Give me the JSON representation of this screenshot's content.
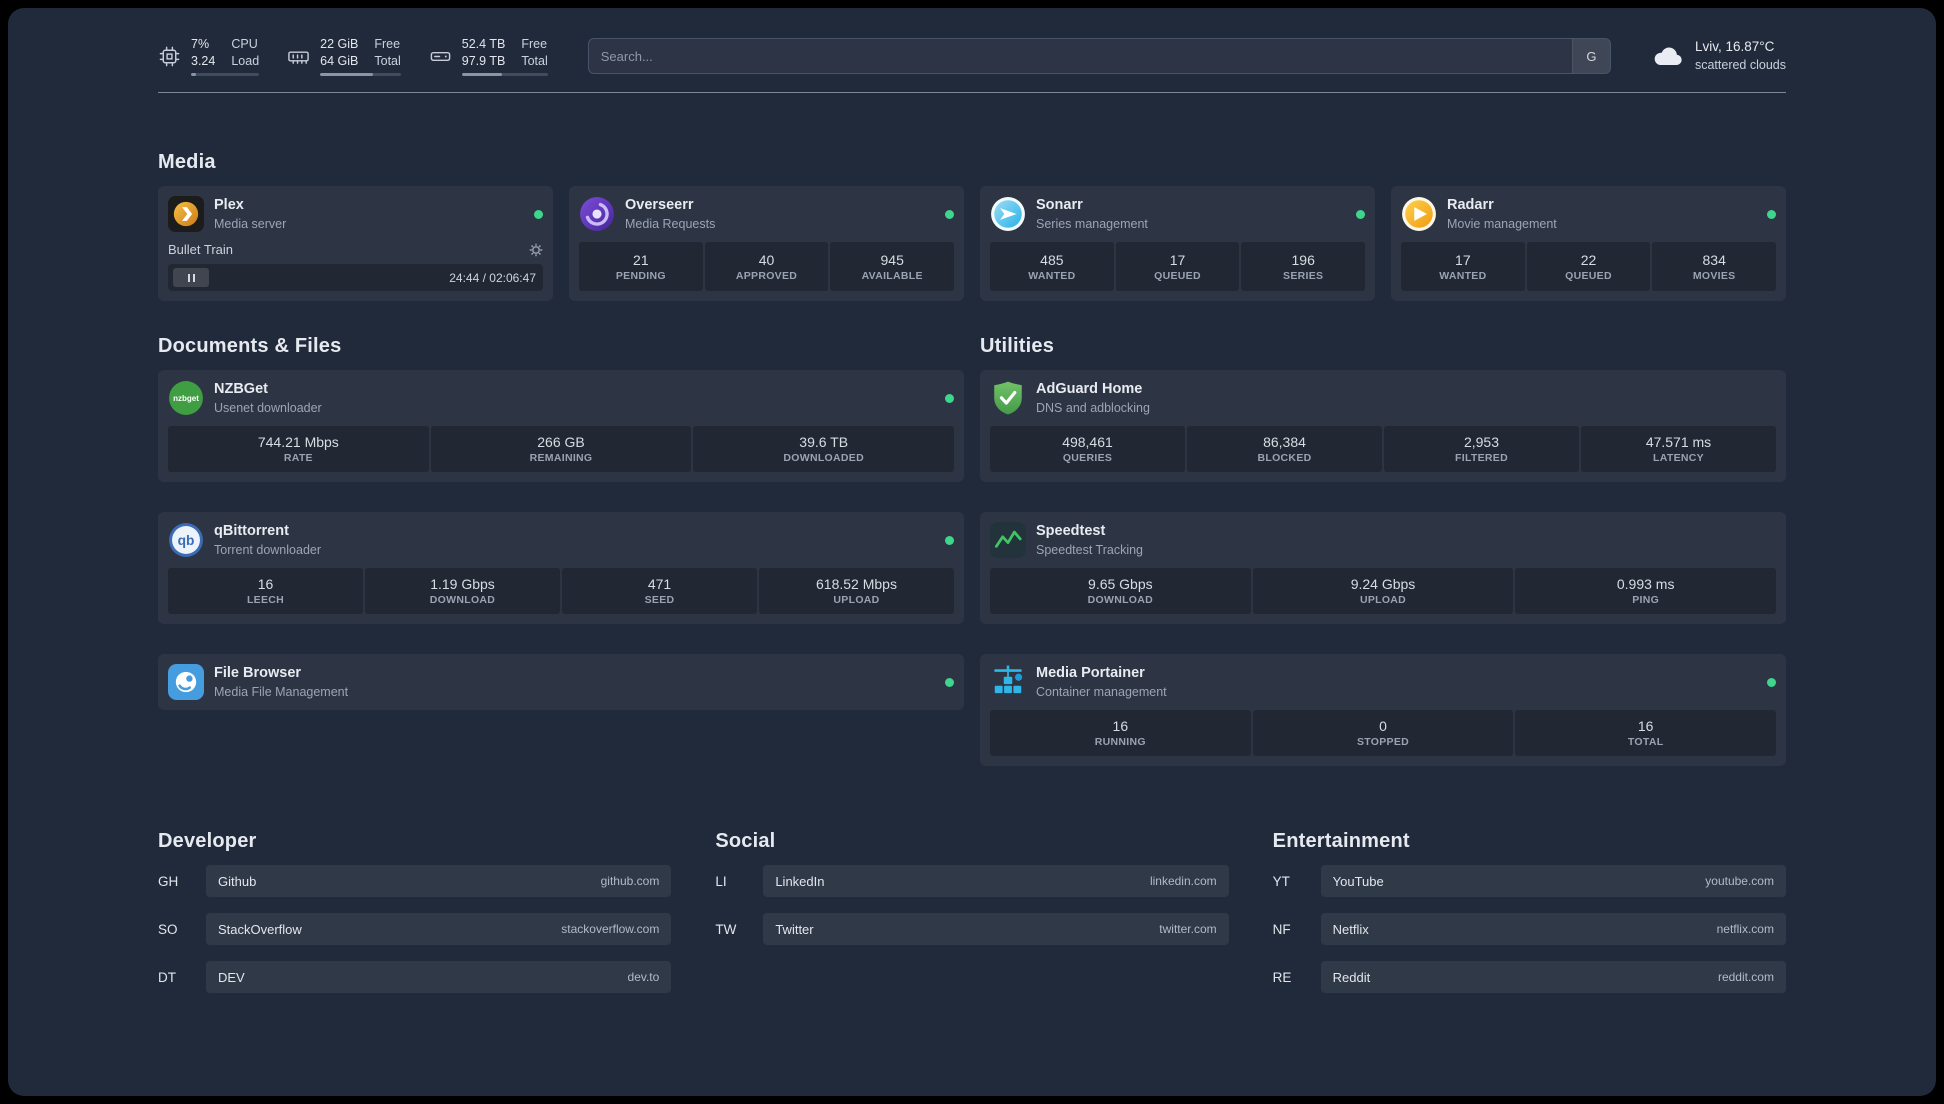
{
  "colors": {
    "status_online": "#3dd68c",
    "background": "#212a3b",
    "accent_green": "#40c463"
  },
  "topbar": {
    "resources": [
      {
        "icon": "cpu-icon",
        "values": [
          "7%",
          "3.24"
        ],
        "labels": [
          "CPU",
          "Load"
        ],
        "progress": 7
      },
      {
        "icon": "memory-icon",
        "values": [
          "22 GiB",
          "64 GiB"
        ],
        "labels": [
          "Free",
          "Total"
        ],
        "progress": 66
      },
      {
        "icon": "disk-icon",
        "values": [
          "52.4 TB",
          "97.9 TB"
        ],
        "labels": [
          "Free",
          "Total"
        ],
        "progress": 47
      }
    ],
    "search": {
      "placeholder": "Search...",
      "provider": "G"
    },
    "weather": {
      "location": "Lviv, 16.87°C",
      "condition": "scattered clouds"
    }
  },
  "media": {
    "title": "Media",
    "plex": {
      "name": "Plex",
      "subtitle": "Media server",
      "status": "online",
      "player": {
        "track": "Bullet Train",
        "time": "24:44 / 02:06:47"
      }
    },
    "overseerr": {
      "name": "Overseerr",
      "subtitle": "Media Requests",
      "status": "online",
      "stats": [
        {
          "value": "21",
          "label": "PENDING"
        },
        {
          "value": "40",
          "label": "APPROVED"
        },
        {
          "value": "945",
          "label": "AVAILABLE"
        }
      ]
    },
    "sonarr": {
      "name": "Sonarr",
      "subtitle": "Series management",
      "status": "online",
      "stats": [
        {
          "value": "485",
          "label": "WANTED"
        },
        {
          "value": "17",
          "label": "QUEUED"
        },
        {
          "value": "196",
          "label": "SERIES"
        }
      ]
    },
    "radarr": {
      "name": "Radarr",
      "subtitle": "Movie management",
      "status": "online",
      "stats": [
        {
          "value": "17",
          "label": "WANTED"
        },
        {
          "value": "22",
          "label": "QUEUED"
        },
        {
          "value": "834",
          "label": "MOVIES"
        }
      ]
    }
  },
  "documents": {
    "title": "Documents & Files",
    "nzbget": {
      "name": "NZBGet",
      "subtitle": "Usenet downloader",
      "status": "online",
      "stats": [
        {
          "value": "744.21 Mbps",
          "label": "RATE"
        },
        {
          "value": "266 GB",
          "label": "REMAINING"
        },
        {
          "value": "39.6 TB",
          "label": "DOWNLOADED"
        }
      ]
    },
    "qbittorrent": {
      "name": "qBittorrent",
      "subtitle": "Torrent downloader",
      "status": "online",
      "stats": [
        {
          "value": "16",
          "label": "LEECH"
        },
        {
          "value": "1.19 Gbps",
          "label": "DOWNLOAD"
        },
        {
          "value": "471",
          "label": "SEED"
        },
        {
          "value": "618.52 Mbps",
          "label": "UPLOAD"
        }
      ]
    },
    "filebrowser": {
      "name": "File Browser",
      "subtitle": "Media File Management",
      "status": "online"
    }
  },
  "utilities": {
    "title": "Utilities",
    "adguard": {
      "name": "AdGuard Home",
      "subtitle": "DNS and adblocking",
      "stats": [
        {
          "value": "498,461",
          "label": "QUERIES"
        },
        {
          "value": "86,384",
          "label": "BLOCKED"
        },
        {
          "value": "2,953",
          "label": "FILTERED"
        },
        {
          "value": "47.571 ms",
          "label": "LATENCY"
        }
      ]
    },
    "speedtest": {
      "name": "Speedtest",
      "subtitle": "Speedtest Tracking",
      "stats": [
        {
          "value": "9.65 Gbps",
          "label": "DOWNLOAD"
        },
        {
          "value": "9.24 Gbps",
          "label": "UPLOAD"
        },
        {
          "value": "0.993 ms",
          "label": "PING"
        }
      ]
    },
    "portainer": {
      "name": "Media Portainer",
      "subtitle": "Container management",
      "status": "online",
      "stats": [
        {
          "value": "16",
          "label": "RUNNING"
        },
        {
          "value": "0",
          "label": "STOPPED"
        },
        {
          "value": "16",
          "label": "TOTAL"
        }
      ]
    }
  },
  "bookmarks": {
    "developer": {
      "title": "Developer",
      "items": [
        {
          "abbr": "GH",
          "name": "Github",
          "url": "github.com"
        },
        {
          "abbr": "SO",
          "name": "StackOverflow",
          "url": "stackoverflow.com"
        },
        {
          "abbr": "DT",
          "name": "DEV",
          "url": "dev.to"
        }
      ]
    },
    "social": {
      "title": "Social",
      "items": [
        {
          "abbr": "LI",
          "name": "LinkedIn",
          "url": "linkedin.com"
        },
        {
          "abbr": "TW",
          "name": "Twitter",
          "url": "twitter.com"
        }
      ]
    },
    "entertainment": {
      "title": "Entertainment",
      "items": [
        {
          "abbr": "YT",
          "name": "YouTube",
          "url": "youtube.com"
        },
        {
          "abbr": "NF",
          "name": "Netflix",
          "url": "netflix.com"
        },
        {
          "abbr": "RE",
          "name": "Reddit",
          "url": "reddit.com"
        }
      ]
    }
  }
}
